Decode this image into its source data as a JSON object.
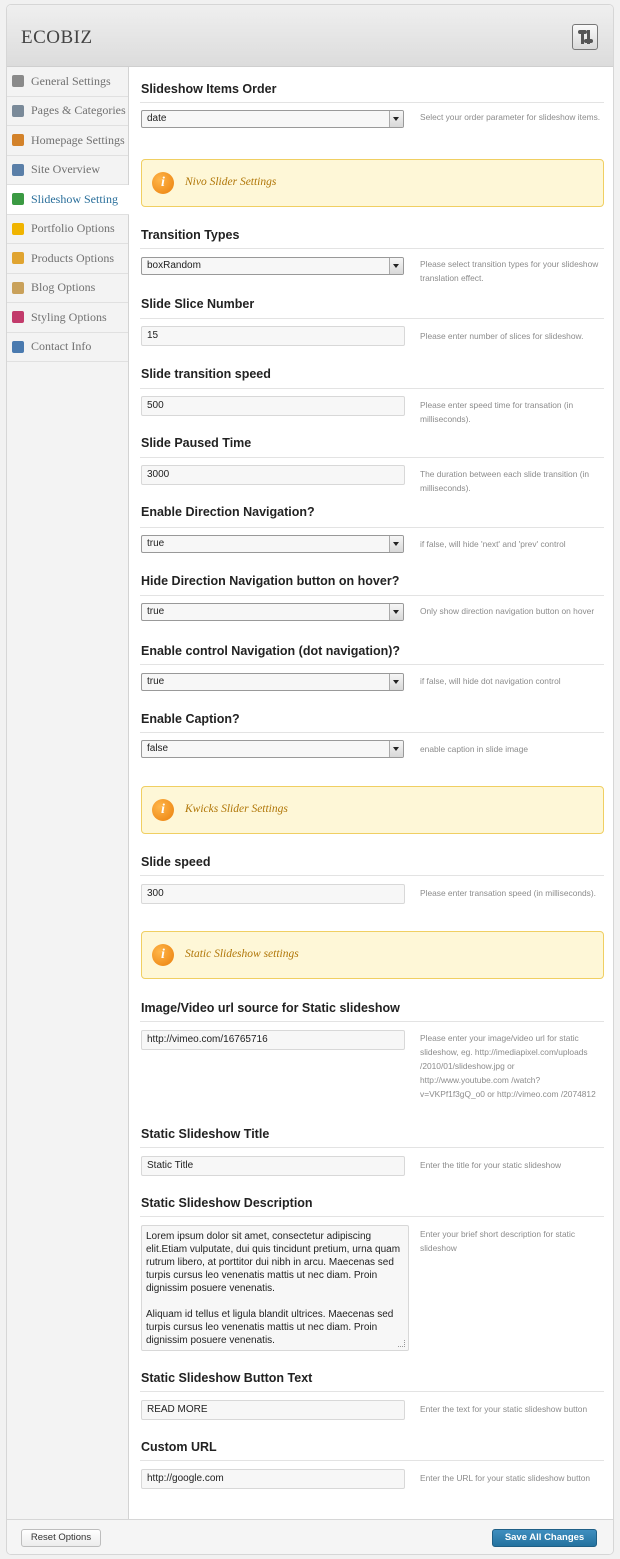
{
  "app": {
    "title": "ECOBIZ"
  },
  "sidebar": {
    "items": [
      {
        "label": "General Settings",
        "icon": "gear-icon",
        "color": "#8a8a8a"
      },
      {
        "label": "Pages & Categories",
        "icon": "chart-icon",
        "color": "#7a8a99"
      },
      {
        "label": "Homepage Settings",
        "icon": "home-icon",
        "color": "#d3822a"
      },
      {
        "label": "Site Overview",
        "icon": "monitor-icon",
        "color": "#5a7fa8"
      },
      {
        "label": "Slideshow Setting",
        "icon": "image-icon",
        "color": "#3b9a43",
        "active": true
      },
      {
        "label": "Portfolio Options",
        "icon": "star-icon",
        "color": "#f0b400"
      },
      {
        "label": "Products Options",
        "icon": "box-icon",
        "color": "#e0a431"
      },
      {
        "label": "Blog Options",
        "icon": "pencil-icon",
        "color": "#c9a15a"
      },
      {
        "label": "Styling Options",
        "icon": "palette-icon",
        "color": "#c23b6b"
      },
      {
        "label": "Contact Info",
        "icon": "contact-icon",
        "color": "#4a7aaf"
      }
    ]
  },
  "fields": {
    "slideshow_order": {
      "title": "Slideshow Items Order",
      "value": "date",
      "desc": "Select your order parameter for slideshow items."
    },
    "nivo_notice": "Nivo Slider Settings",
    "transition_types": {
      "title": "Transition Types",
      "value": "boxRandom",
      "desc": "Please select transition types for your slideshow translation effect."
    },
    "slice_number": {
      "title": "Slide Slice Number",
      "value": "15",
      "desc": "Please enter number of slices for slideshow."
    },
    "transition_speed": {
      "title": "Slide transition speed",
      "value": "500",
      "desc": "Please enter speed time for transation (in milliseconds)."
    },
    "paused_time": {
      "title": "Slide Paused Time",
      "value": "3000",
      "desc": "The duration between each slide transition (in milliseconds)."
    },
    "direction_nav": {
      "title": "Enable Direction Navigation?",
      "value": "true",
      "desc": "if false, will hide 'next' and 'prev' control"
    },
    "hide_direction_nav": {
      "title": "Hide Direction Navigation button on hover?",
      "value": "true",
      "desc": "Only show direction navigation button on hover"
    },
    "control_nav": {
      "title": "Enable control Navigation (dot navigation)?",
      "value": "true",
      "desc": "if false, will hide dot navigation control"
    },
    "caption": {
      "title": "Enable Caption?",
      "value": "false",
      "desc": "enable caption in slide image"
    },
    "kwicks_notice": "Kwicks Slider Settings",
    "slide_speed": {
      "title": "Slide speed",
      "value": "300",
      "desc": "Please enter transation speed (in milliseconds)."
    },
    "static_notice": "Static Slideshow settings",
    "static_url": {
      "title": "Image/Video url source for Static slideshow",
      "value": "http://vimeo.com/16765716",
      "desc": "Please enter your image/video url for static slideshow, eg. http://imediapixel.com/uploads /2010/01/slideshow.jpg or http://www.youtube.com /watch?v=VKPf1f3gQ_o0 or http://vimeo.com /2074812"
    },
    "static_title": {
      "title": "Static Slideshow Title",
      "value": "Static Title",
      "desc": "Enter the title for your static slideshow"
    },
    "static_desc": {
      "title": "Static Slideshow Description",
      "p1": "Lorem ipsum dolor sit amet, consectetur adipiscing elit.Etiam vulputate, dui quis tincidunt pretium, urna quam rutrum libero, at porttitor dui nibh in arcu. Maecenas sed turpis cursus leo venenatis mattis ut nec diam. Proin dignissim posuere venenatis.",
      "p2": "Aliquam id tellus et ligula blandit ultrices. Maecenas sed turpis cursus leo venenatis mattis ut nec diam. Proin dignissim posuere venenatis.",
      "desc": "Enter your brief short description for static slideshow"
    },
    "button_text": {
      "title": "Static Slideshow Button Text",
      "value": "READ MORE",
      "desc": "Enter the text for your static slideshow button"
    },
    "custom_url": {
      "title": "Custom URL",
      "value": "http://google.com",
      "desc": "Enter the URL for your static slideshow button"
    }
  },
  "footer": {
    "reset_label": "Reset Options",
    "save_label": "Save All Changes"
  }
}
